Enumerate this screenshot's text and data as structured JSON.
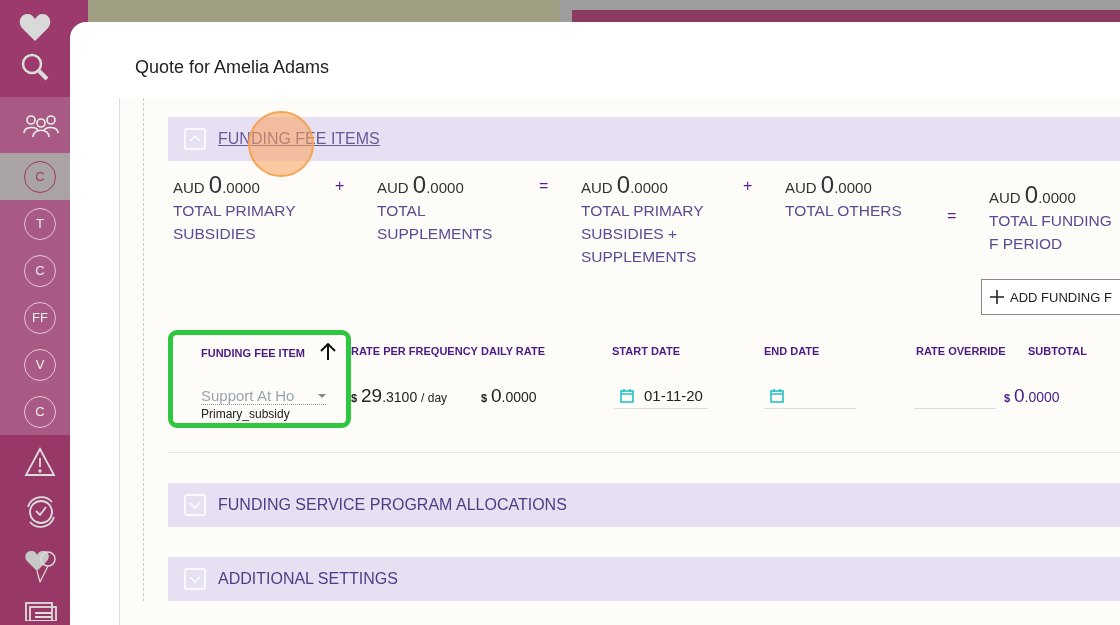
{
  "sidebar": {
    "letter_items": [
      {
        "label": "C",
        "selected": true
      },
      {
        "label": "T",
        "selected": false
      },
      {
        "label": "C",
        "selected": false
      },
      {
        "label": "FF",
        "selected": false
      },
      {
        "label": "V",
        "selected": false
      },
      {
        "label": "C",
        "selected": false
      }
    ]
  },
  "dialog": {
    "title": "Quote for Amelia Adams"
  },
  "funding_fee_items": {
    "title": "FUNDING FEE ITEMS",
    "expanded": true,
    "totals": [
      {
        "currency": "AUD",
        "whole": "0",
        "decimals": ".0000",
        "label": "TOTAL PRIMARY SUBSIDIES",
        "operator": "+"
      },
      {
        "currency": "AUD",
        "whole": "0",
        "decimals": ".0000",
        "label": "TOTAL SUPPLEMENTS",
        "operator": "="
      },
      {
        "currency": "AUD",
        "whole": "0",
        "decimals": ".0000",
        "label": "TOTAL PRIMARY SUBSIDIES + SUPPLEMENTS",
        "operator": "+"
      },
      {
        "currency": "AUD",
        "whole": "0",
        "decimals": ".0000",
        "label": "TOTAL OTHERS",
        "operator": "="
      },
      {
        "currency": "AUD",
        "whole": "0",
        "decimals": ".0000",
        "label": "TOTAL FUNDING F PERIOD"
      }
    ],
    "add_button": "ADD FUNDING F",
    "columns": [
      "FUNDING FEE ITEM",
      "RATE PER FREQUENCY",
      "DAILY RATE",
      "START DATE",
      "END DATE",
      "RATE OVERRIDE",
      "SUBTOTAL"
    ],
    "rows": [
      {
        "item": "Support At Ho",
        "item_type": "Primary_subsidy",
        "rate": {
          "symbol": "$",
          "whole": "29",
          "decimals": ".3100",
          "unit": "/ day"
        },
        "daily_rate": {
          "symbol": "$",
          "whole": "0",
          "decimals": ".0000"
        },
        "start_date": "01-11-20",
        "end_date": "",
        "rate_override": "",
        "subtotal": {
          "symbol": "$",
          "whole": "0",
          "decimals": ".0000"
        }
      }
    ]
  },
  "collapsed_sections": [
    {
      "title": "FUNDING SERVICE PROGRAM ALLOCATIONS",
      "expanded": false
    },
    {
      "title": "ADDITIONAL SETTINGS",
      "expanded": false
    }
  ]
}
